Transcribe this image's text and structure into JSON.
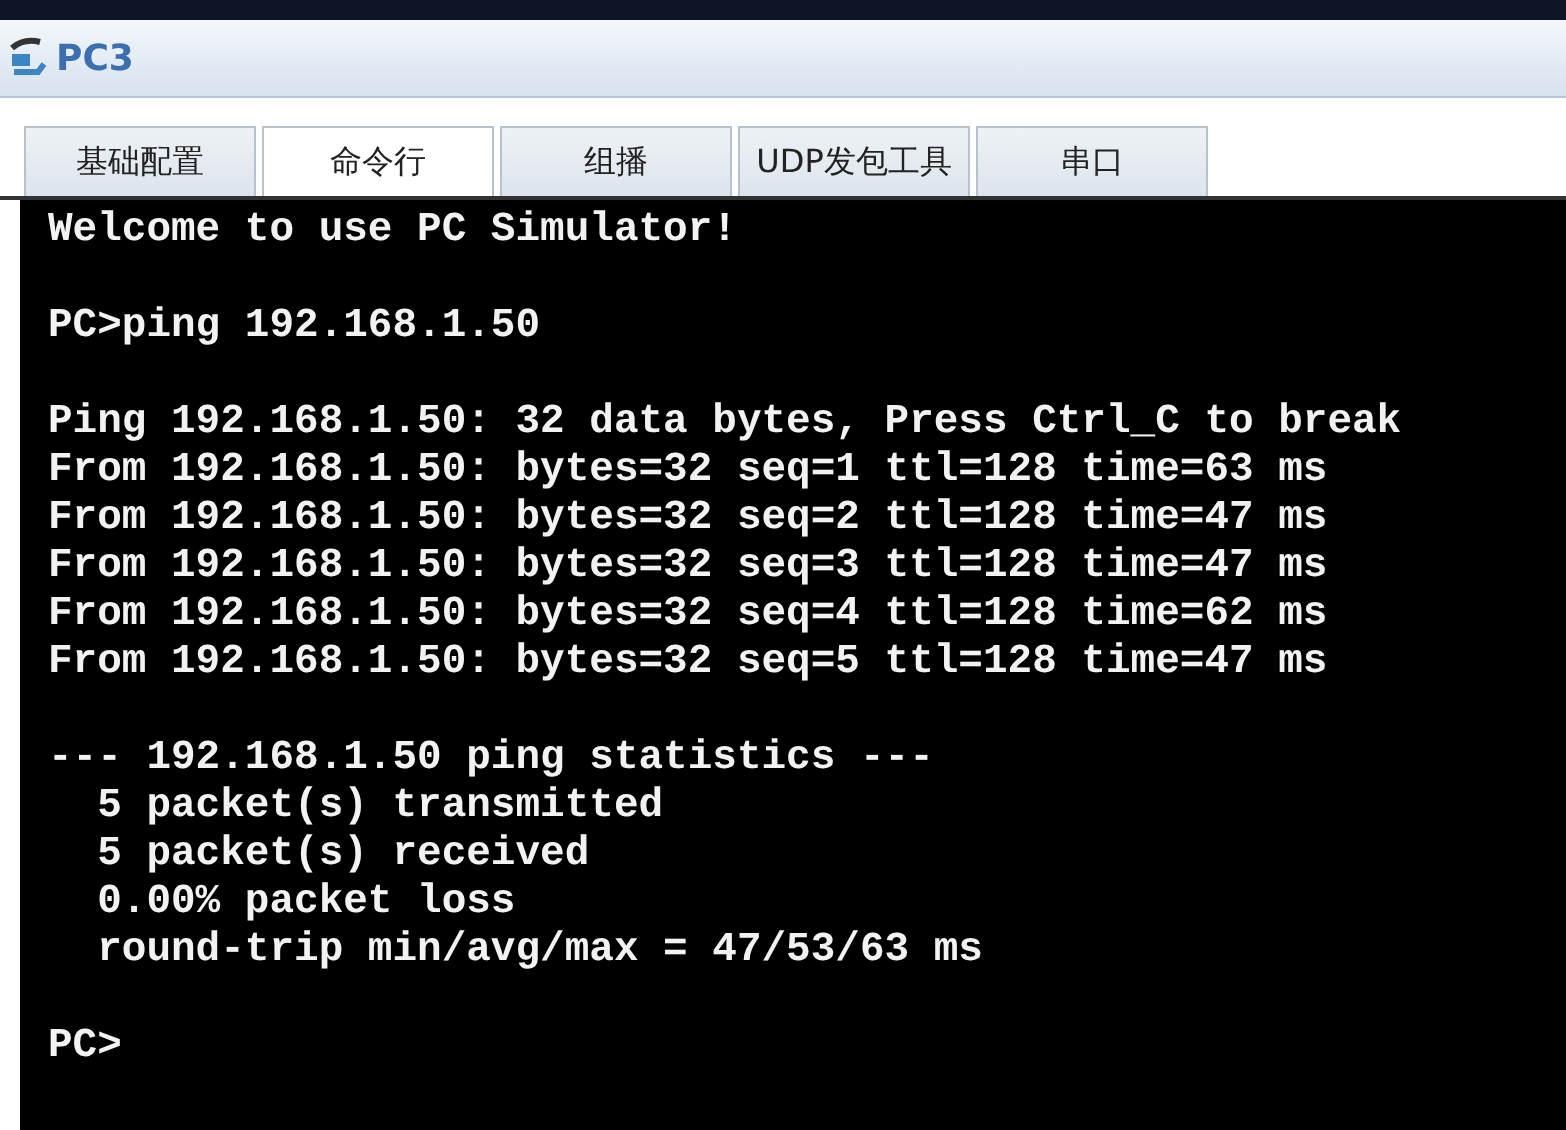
{
  "window": {
    "title": "PC3"
  },
  "tabs": [
    {
      "label": "基础配置",
      "selected": false
    },
    {
      "label": "命令行",
      "selected": true
    },
    {
      "label": "组播",
      "selected": false
    },
    {
      "label": "UDP发包工具",
      "selected": false
    },
    {
      "label": "串口",
      "selected": false
    }
  ],
  "terminal": {
    "blocks": [
      {
        "lines": [
          "Welcome to use PC Simulator!"
        ]
      },
      {
        "lines": [
          "PC>ping 192.168.1.50"
        ]
      },
      {
        "lines": [
          "Ping 192.168.1.50: 32 data bytes, Press Ctrl_C to break",
          "From 192.168.1.50: bytes=32 seq=1 ttl=128 time=63 ms",
          "From 192.168.1.50: bytes=32 seq=2 ttl=128 time=47 ms",
          "From 192.168.1.50: bytes=32 seq=3 ttl=128 time=47 ms",
          "From 192.168.1.50: bytes=32 seq=4 ttl=128 time=62 ms",
          "From 192.168.1.50: bytes=32 seq=5 ttl=128 time=47 ms"
        ]
      },
      {
        "lines": [
          "--- 192.168.1.50 ping statistics ---",
          "  5 packet(s) transmitted",
          "  5 packet(s) received",
          "  0.00% packet loss",
          "  round-trip min/avg/max = 47/53/63 ms"
        ]
      },
      {
        "lines": [
          "PC>"
        ]
      }
    ]
  }
}
